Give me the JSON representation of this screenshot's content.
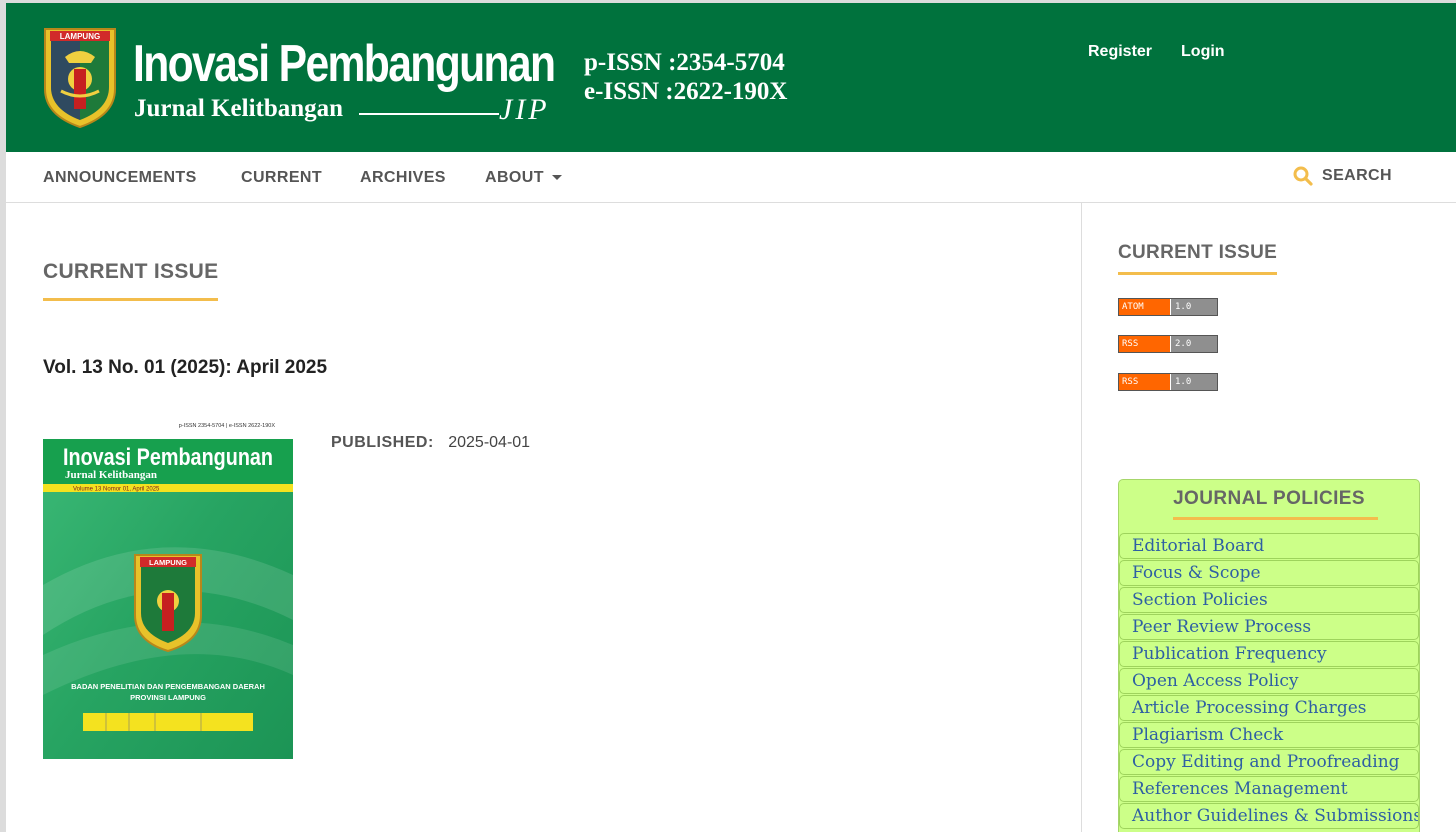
{
  "header": {
    "brand_title": "Inovasi Pembangunan",
    "brand_subtitle": "Jurnal Kelitbangan",
    "brand_code": "JIP",
    "emblem_label": "LAMPUNG",
    "issn_print": "p-ISSN :2354-5704",
    "issn_electronic": "e-ISSN :2622-190X",
    "register_label": "Register",
    "login_label": "Login"
  },
  "nav": {
    "items": [
      "ANNOUNCEMENTS",
      "CURRENT",
      "ARCHIVES",
      "ABOUT"
    ],
    "search_label": "SEARCH"
  },
  "main": {
    "heading": "CURRENT ISSUE",
    "issue_title": "Vol. 13 No. 01 (2025): April 2025",
    "published_label": "PUBLISHED:",
    "published_date": "2025-04-01",
    "cover": {
      "issn_line": "p-ISSN 2354-5704 | e-ISSN 2622-190X",
      "title": "Inovasi Pembangunan",
      "subtitle": "Jurnal Kelitbangan",
      "volume_line": "Volume 13 Nomor 01, April 2025",
      "emblem_label": "LAMPUNG",
      "agency_line1": "BADAN PENELITIAN DAN PENGEMBANGAN DAERAH",
      "agency_line2": "PROVINSI LAMPUNG"
    }
  },
  "sidebar": {
    "heading": "CURRENT ISSUE",
    "feeds": [
      {
        "kind": "ATOM",
        "version": "1.0"
      },
      {
        "kind": "RSS",
        "version": "2.0"
      },
      {
        "kind": "RSS",
        "version": "1.0"
      }
    ],
    "policies_heading": "JOURNAL POLICIES",
    "policies": [
      "Editorial Board",
      "Focus & Scope",
      "Section Policies",
      "Peer Review Process",
      "Publication Frequency",
      "Open Access Policy",
      "Article Processing Charges",
      "Plagiarism Check",
      "Copy Editing and Proofreading",
      "References Management",
      "Author Guidelines & Submissions"
    ]
  },
  "colors": {
    "header_green": "#00723d",
    "accent_gold": "#f3bd4c",
    "policy_bg": "#ccff88",
    "link_blue": "#2e5fa3"
  }
}
